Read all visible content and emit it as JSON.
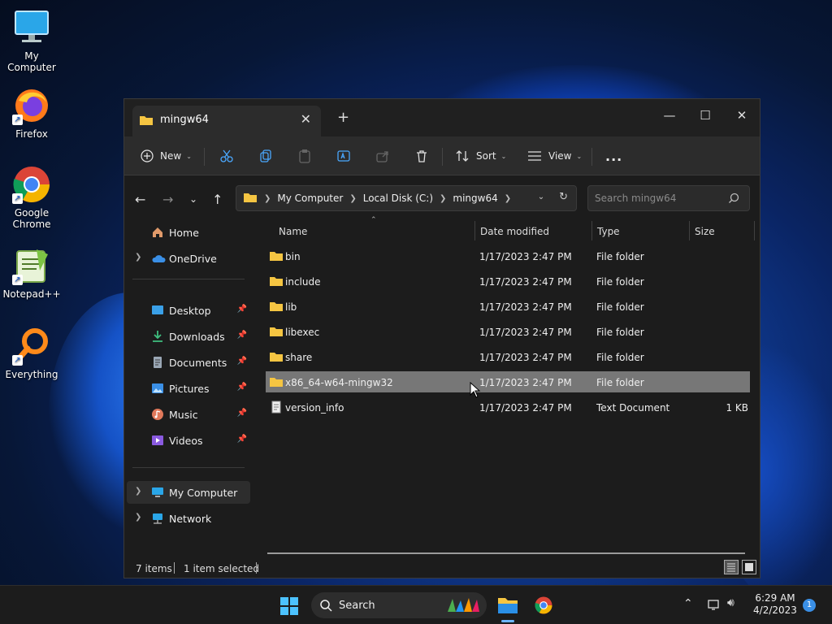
{
  "desktop": {
    "icons": [
      {
        "label": "My Computer",
        "icon": "monitor-icon"
      },
      {
        "label": "Firefox",
        "icon": "firefox-icon"
      },
      {
        "label": "Google Chrome",
        "icon": "chrome-icon"
      },
      {
        "label": "Notepad++",
        "icon": "notepadpp-icon"
      },
      {
        "label": "Everything",
        "icon": "everything-icon"
      }
    ]
  },
  "explorer": {
    "tab_title": "mingw64",
    "toolbar": {
      "new_label": "New",
      "sort_label": "Sort",
      "view_label": "View",
      "more_label": "..."
    },
    "breadcrumb": [
      "My Computer",
      "Local Disk (C:)",
      "mingw64"
    ],
    "search_placeholder": "Search mingw64",
    "sidebar": {
      "home": "Home",
      "onedrive": "OneDrive",
      "quick": [
        {
          "label": "Desktop",
          "icon": "desktop-folder-icon",
          "color": "#3aa0e8"
        },
        {
          "label": "Downloads",
          "icon": "download-icon",
          "color": "#3fbf7f"
        },
        {
          "label": "Documents",
          "icon": "documents-icon",
          "color": "#9aa7b5"
        },
        {
          "label": "Pictures",
          "icon": "pictures-icon",
          "color": "#3a8fe6"
        },
        {
          "label": "Music",
          "icon": "music-icon",
          "color": "#e0785a"
        },
        {
          "label": "Videos",
          "icon": "videos-icon",
          "color": "#8a5ae0"
        }
      ],
      "my_computer": "My Computer",
      "network": "Network"
    },
    "columns": {
      "name": "Name",
      "date": "Date modified",
      "type": "Type",
      "size": "Size"
    },
    "files": [
      {
        "name": "bin",
        "date": "1/17/2023 2:47 PM",
        "type": "File folder",
        "size": "",
        "kind": "folder"
      },
      {
        "name": "include",
        "date": "1/17/2023 2:47 PM",
        "type": "File folder",
        "size": "",
        "kind": "folder"
      },
      {
        "name": "lib",
        "date": "1/17/2023 2:47 PM",
        "type": "File folder",
        "size": "",
        "kind": "folder"
      },
      {
        "name": "libexec",
        "date": "1/17/2023 2:47 PM",
        "type": "File folder",
        "size": "",
        "kind": "folder"
      },
      {
        "name": "share",
        "date": "1/17/2023 2:47 PM",
        "type": "File folder",
        "size": "",
        "kind": "folder"
      },
      {
        "name": "x86_64-w64-mingw32",
        "date": "1/17/2023 2:47 PM",
        "type": "File folder",
        "size": "",
        "kind": "folder",
        "selected": true
      },
      {
        "name": "version_info",
        "date": "1/17/2023 2:47 PM",
        "type": "Text Document",
        "size": "1 KB",
        "kind": "text"
      }
    ],
    "status": {
      "count": "7 items",
      "selected": "1 item selected"
    }
  },
  "taskbar": {
    "search_label": "Search",
    "time": "6:29 AM",
    "date": "4/2/2023",
    "notifications": "1"
  },
  "colors": {
    "folder": "#f5c542",
    "accent": "#6cb6ff",
    "selection": "#777777"
  }
}
